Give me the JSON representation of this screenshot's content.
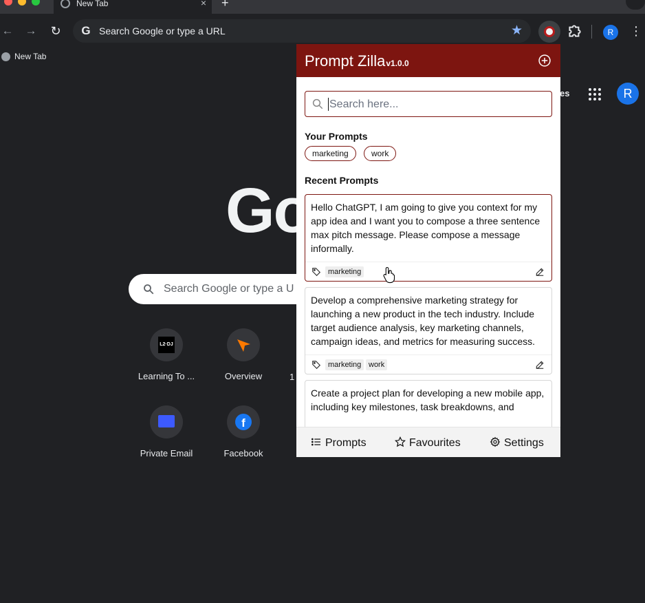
{
  "browser": {
    "tab_title": "New Tab",
    "tab_close": "×",
    "new_tab": "+",
    "omnibox_placeholder": "Search Google or type a URL",
    "profile_initial": "R",
    "bookmarks": [
      {
        "label": "New Tab"
      }
    ]
  },
  "ntp": {
    "top_link_partial": "es",
    "avatar_initial": "R",
    "logo_partial": "Go",
    "search_placeholder": "Search Google or type a U",
    "shortcuts": [
      {
        "label": "Learning To ...",
        "favicon_text": "L2·DJ"
      },
      {
        "label": "Overview"
      },
      {
        "label": "Private Email"
      },
      {
        "label": "Facebook",
        "favicon_text": "f"
      }
    ],
    "partial_label": "1"
  },
  "extension": {
    "title": "Prompt Zilla",
    "version": "v1.0.0",
    "accent_color": "#7d1510",
    "search_placeholder": "Search here...",
    "your_prompts_title": "Your Prompts",
    "tags": [
      "marketing",
      "work"
    ],
    "recent_prompts_title": "Recent Prompts",
    "prompts": [
      {
        "text": "Hello ChatGPT, I am going to give you context for my app idea and I want you to compose a three sentence max pitch message. Please compose a message informally.",
        "tags": [
          "marketing"
        ]
      },
      {
        "text": "Develop a comprehensive marketing strategy for launching a new product in the tech industry. Include target audience analysis, key marketing channels, campaign ideas, and metrics for measuring success.",
        "tags": [
          "marketing",
          "work"
        ]
      },
      {
        "text": "Create a project plan for developing a new mobile app, including key milestones, task breakdowns, and",
        "tags": []
      }
    ],
    "footer": {
      "prompts": "Prompts",
      "favourites": "Favourites",
      "settings": "Settings"
    }
  }
}
